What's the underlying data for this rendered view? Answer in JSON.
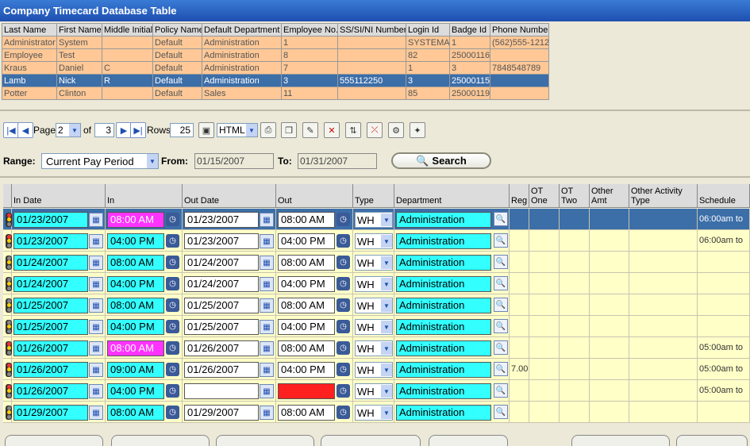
{
  "window": {
    "title": "Company Timecard Database Table"
  },
  "employee_table": {
    "columns": [
      "Last Name",
      "First Name",
      "Middle Initial",
      "Policy Name",
      "Default Department",
      "Employee No.",
      "SS/SI/NI Number",
      "Login Id",
      "Badge Id",
      "Phone Number"
    ],
    "rows": [
      [
        "Administrator",
        "System",
        "",
        "Default",
        "Administration",
        "1",
        "",
        "SYSTEMAD",
        "1",
        "(562)555-1212"
      ],
      [
        "Employee",
        "Test",
        "",
        "Default",
        "Administration",
        "8",
        "",
        "82",
        "25000116",
        ""
      ],
      [
        "Kraus",
        "Daniel",
        "C",
        "Default",
        "Administration",
        "7",
        "",
        "1",
        "3",
        "7848548789"
      ],
      [
        "Lamb",
        "Nick",
        "R",
        "Default",
        "Administration",
        "3",
        "555112250",
        "3",
        "25000115",
        ""
      ],
      [
        "Potter",
        "Clinton",
        "",
        "Default",
        "Sales",
        "11",
        "",
        "85",
        "25000119",
        ""
      ]
    ],
    "selected_row": 3
  },
  "toolbar": {
    "page_label": "Page",
    "page_value": "2",
    "of_label": "of",
    "total_pages": "3",
    "rows_label": "Rows",
    "rows_value": "25",
    "format_value": "HTML"
  },
  "range": {
    "label": "Range:",
    "value": "Current Pay Period",
    "from_label": "From:",
    "from_value": "01/15/2007",
    "to_label": "To:",
    "to_value": "01/31/2007",
    "search_label": "Search"
  },
  "grid": {
    "columns": [
      "In Date",
      "In",
      "Out Date",
      "Out",
      "Type",
      "Department",
      "Reg",
      "OT One",
      "OT Two",
      "Other Amt",
      "Other Activity Type",
      "Schedule"
    ],
    "rows": [
      {
        "in_date": "01/23/2007",
        "in": "08:00 AM",
        "in_flag": "magenta",
        "out_date": "01/23/2007",
        "out": "08:00 AM",
        "out_flag": "",
        "type": "WH",
        "dept": "Administration",
        "reg": "",
        "schedule": "06:00am to",
        "light": "red"
      },
      {
        "in_date": "01/23/2007",
        "in": "04:00 PM",
        "in_flag": "",
        "out_date": "01/23/2007",
        "out": "04:00 PM",
        "out_flag": "",
        "type": "WH",
        "dept": "Administration",
        "reg": "",
        "schedule": "06:00am to",
        "light": "red"
      },
      {
        "in_date": "01/24/2007",
        "in": "08:00 AM",
        "in_flag": "",
        "out_date": "01/24/2007",
        "out": "08:00 AM",
        "out_flag": "",
        "type": "WH",
        "dept": "Administration",
        "reg": "",
        "schedule": "",
        "light": "gray"
      },
      {
        "in_date": "01/24/2007",
        "in": "04:00 PM",
        "in_flag": "",
        "out_date": "01/24/2007",
        "out": "04:00 PM",
        "out_flag": "",
        "type": "WH",
        "dept": "Administration",
        "reg": "",
        "schedule": "",
        "light": "gray"
      },
      {
        "in_date": "01/25/2007",
        "in": "08:00 AM",
        "in_flag": "",
        "out_date": "01/25/2007",
        "out": "08:00 AM",
        "out_flag": "",
        "type": "WH",
        "dept": "Administration",
        "reg": "",
        "schedule": "",
        "light": "gray"
      },
      {
        "in_date": "01/25/2007",
        "in": "04:00 PM",
        "in_flag": "",
        "out_date": "01/25/2007",
        "out": "04:00 PM",
        "out_flag": "",
        "type": "WH",
        "dept": "Administration",
        "reg": "",
        "schedule": "",
        "light": "gray"
      },
      {
        "in_date": "01/26/2007",
        "in": "08:00 AM",
        "in_flag": "magenta",
        "out_date": "01/26/2007",
        "out": "08:00 AM",
        "out_flag": "",
        "type": "WH",
        "dept": "Administration",
        "reg": "",
        "schedule": "05:00am to",
        "light": "red"
      },
      {
        "in_date": "01/26/2007",
        "in": "09:00 AM",
        "in_flag": "",
        "out_date": "01/26/2007",
        "out": "04:00 PM",
        "out_flag": "",
        "type": "WH",
        "dept": "Administration",
        "reg": "7.00",
        "schedule": "05:00am to",
        "light": "red"
      },
      {
        "in_date": "01/26/2007",
        "in": "04:00 PM",
        "in_flag": "",
        "out_date": "",
        "out": "",
        "out_flag": "red",
        "type": "WH",
        "dept": "Administration",
        "reg": "",
        "schedule": "05:00am to",
        "light": "red"
      },
      {
        "in_date": "01/29/2007",
        "in": "08:00 AM",
        "in_flag": "",
        "out_date": "01/29/2007",
        "out": "08:00 AM",
        "out_flag": "",
        "type": "WH",
        "dept": "Administration",
        "reg": "",
        "schedule": "",
        "light": "gray"
      }
    ],
    "selected_row": 0
  },
  "colors": {
    "accent": "#1f4fb0",
    "selected": "#3c6ea8",
    "row_bg": "#ffc896",
    "grid_bg": "#ffffc8",
    "cyan": "#33ffff",
    "magenta": "#ff33ff",
    "error": "#ff2020"
  }
}
